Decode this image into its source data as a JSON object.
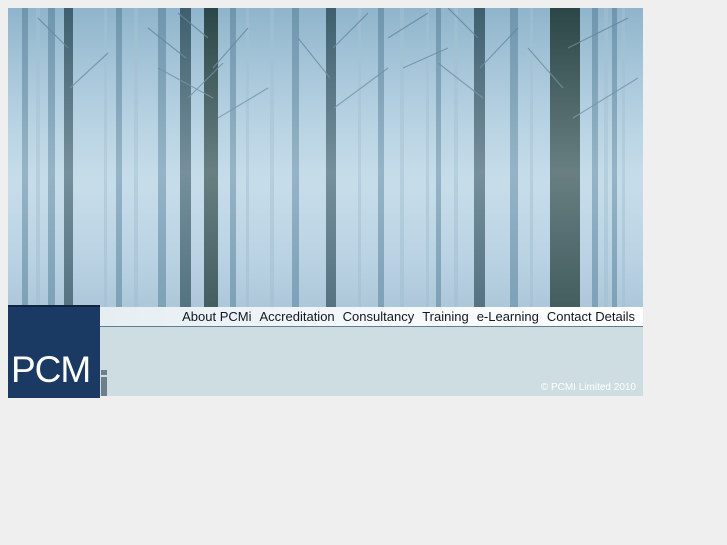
{
  "nav": {
    "items": [
      {
        "label": "About PCMi"
      },
      {
        "label": "Accreditation"
      },
      {
        "label": "Consultancy"
      },
      {
        "label": "Training"
      },
      {
        "label": "e-Learning"
      },
      {
        "label": "Contact Details"
      }
    ]
  },
  "logo": {
    "text": "PCM",
    "suffix": "i"
  },
  "footer": {
    "copyright": "© PCMI Limited 2010"
  },
  "colors": {
    "logo_background": "#1b3a63",
    "panel_background": "#cddde2",
    "page_background": "#efefef"
  }
}
